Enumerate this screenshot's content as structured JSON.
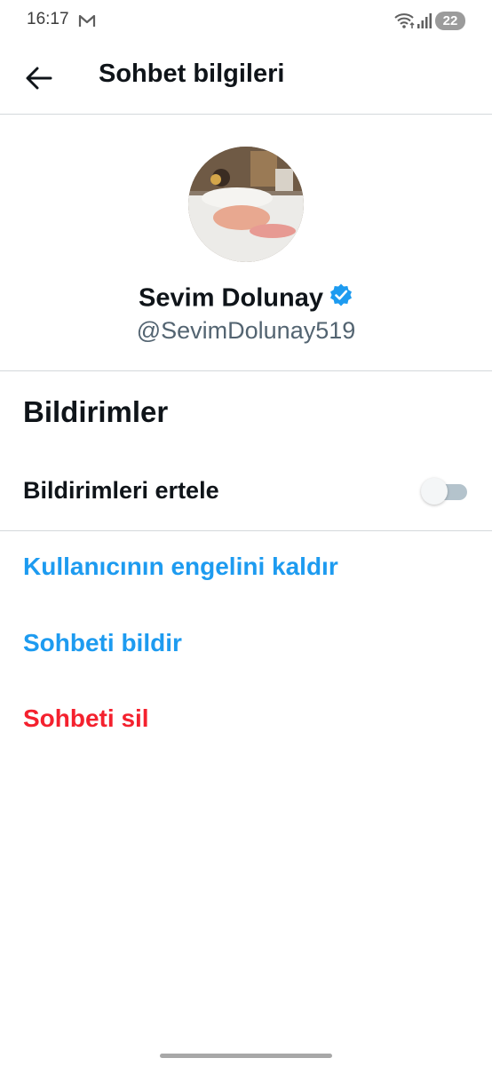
{
  "status_bar": {
    "time": "16:17",
    "notification_icon": "gmail-icon",
    "battery": "22"
  },
  "header": {
    "back_icon": "arrow-left-icon",
    "title": "Sohbet bilgileri"
  },
  "profile": {
    "name": "Sevim Dolunay",
    "handle": "@SevimDolunay519",
    "verified": true,
    "verified_color": "#1d9bf0"
  },
  "notifications": {
    "section_title": "Bildirimler",
    "snooze_label": "Bildirimleri ertele",
    "snooze_enabled": false
  },
  "actions": {
    "unblock": "Kullanıcının engelini kaldır",
    "report": "Sohbeti bildir",
    "delete": "Sohbeti sil"
  },
  "colors": {
    "accent": "#1d9bf0",
    "danger": "#f4212e",
    "text": "#0f1419",
    "secondary_text": "#536471"
  }
}
